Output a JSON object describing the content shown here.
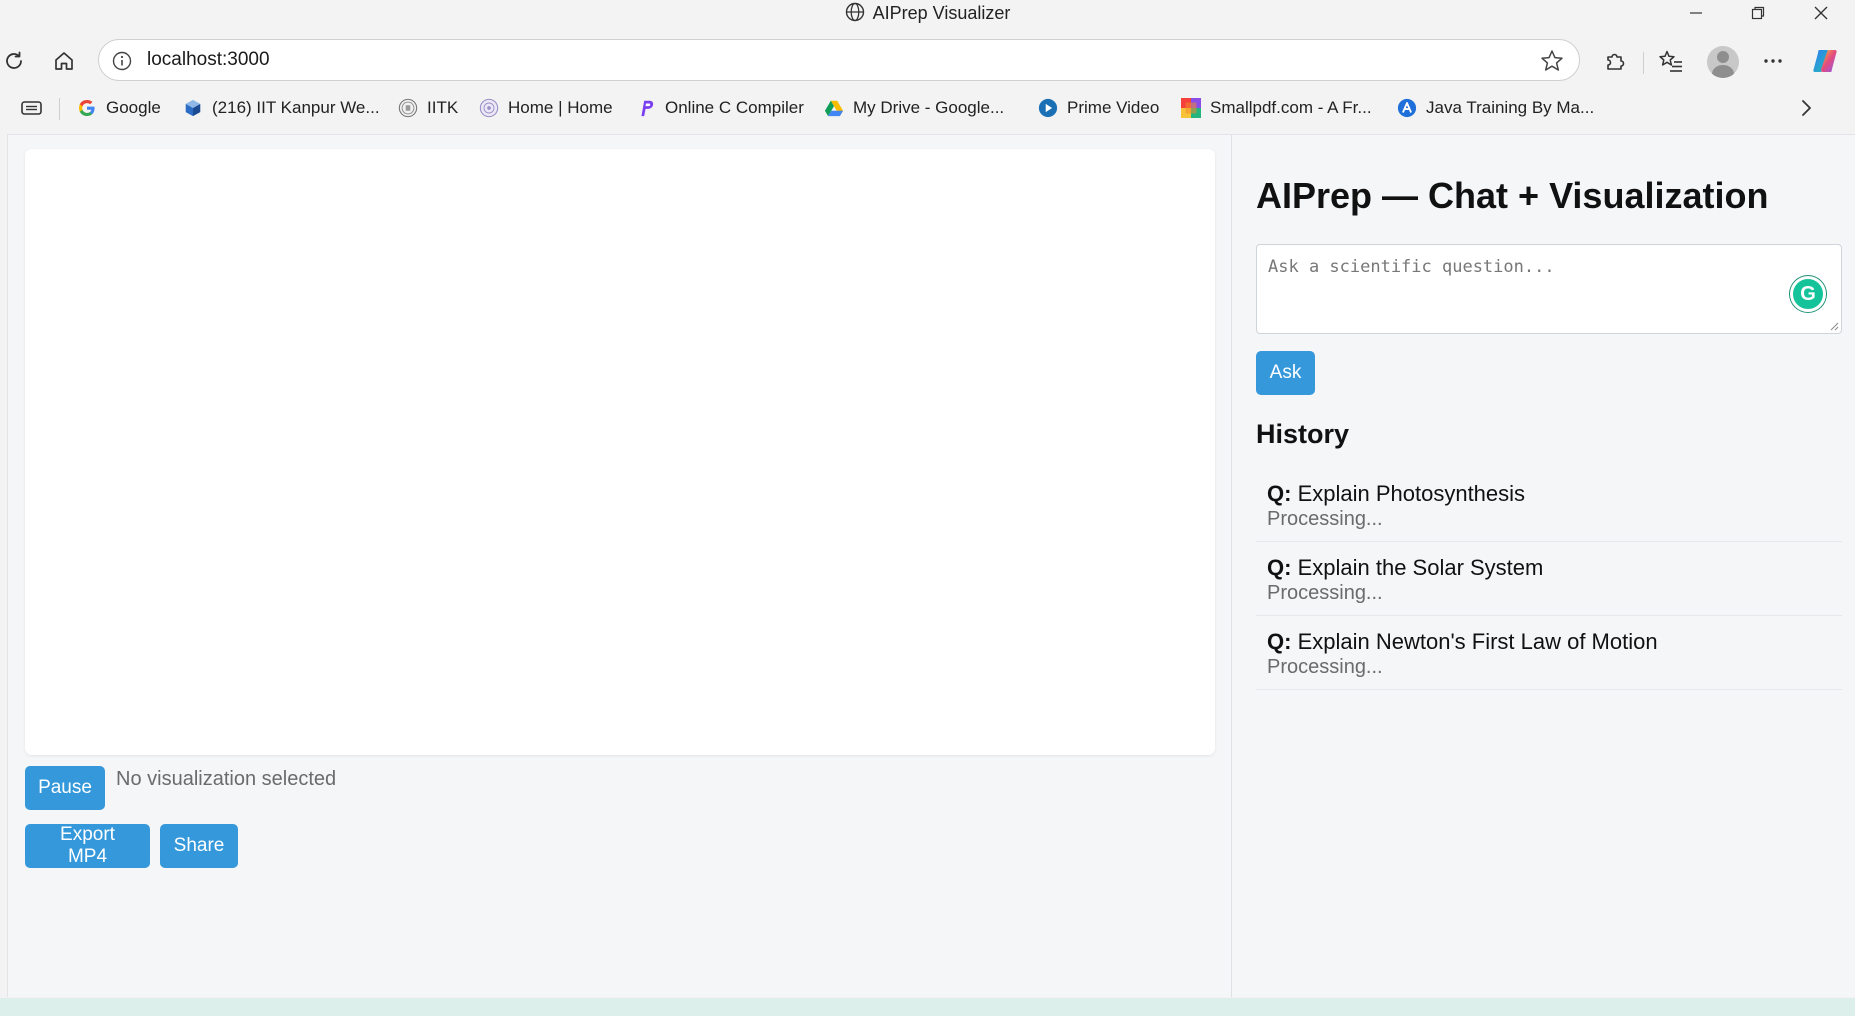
{
  "window": {
    "title": "AIPrep Visualizer"
  },
  "browser": {
    "url": "localhost:3000",
    "bookmarks": [
      {
        "label": "Google",
        "icon": "google-icon"
      },
      {
        "label": "(216) IIT Kanpur We...",
        "icon": "cube-icon"
      },
      {
        "label": "IITK",
        "icon": "iitk-seal-icon"
      },
      {
        "label": "Home | Home",
        "icon": "home-seal-icon"
      },
      {
        "label": "Online C Compiler",
        "icon": "compiler-icon"
      },
      {
        "label": "My Drive - Google...",
        "icon": "drive-icon"
      },
      {
        "label": "Prime Video",
        "icon": "prime-video-icon"
      },
      {
        "label": "Smallpdf.com - A Fr...",
        "icon": "smallpdf-icon"
      },
      {
        "label": "Java Training By Ma...",
        "icon": "java-training-icon"
      }
    ]
  },
  "app": {
    "controls": {
      "pause_label": "Pause",
      "status_text": "No visualization selected",
      "export_label": "Export MP4",
      "share_label": "Share"
    },
    "panel": {
      "title": "AIPrep — Chat + Visualization",
      "ask_placeholder": "Ask a scientific question...",
      "ask_button": "Ask",
      "history_title": "History",
      "history": [
        {
          "prefix": "Q:",
          "question": "Explain Photosynthesis",
          "status": "Processing..."
        },
        {
          "prefix": "Q:",
          "question": "Explain the Solar System",
          "status": "Processing..."
        },
        {
          "prefix": "Q:",
          "question": "Explain Newton's First Law of Motion",
          "status": "Processing..."
        }
      ]
    }
  },
  "colors": {
    "accent": "#3498db",
    "page_bg": "#f4f6f8",
    "grammarly": "#15c39a"
  }
}
